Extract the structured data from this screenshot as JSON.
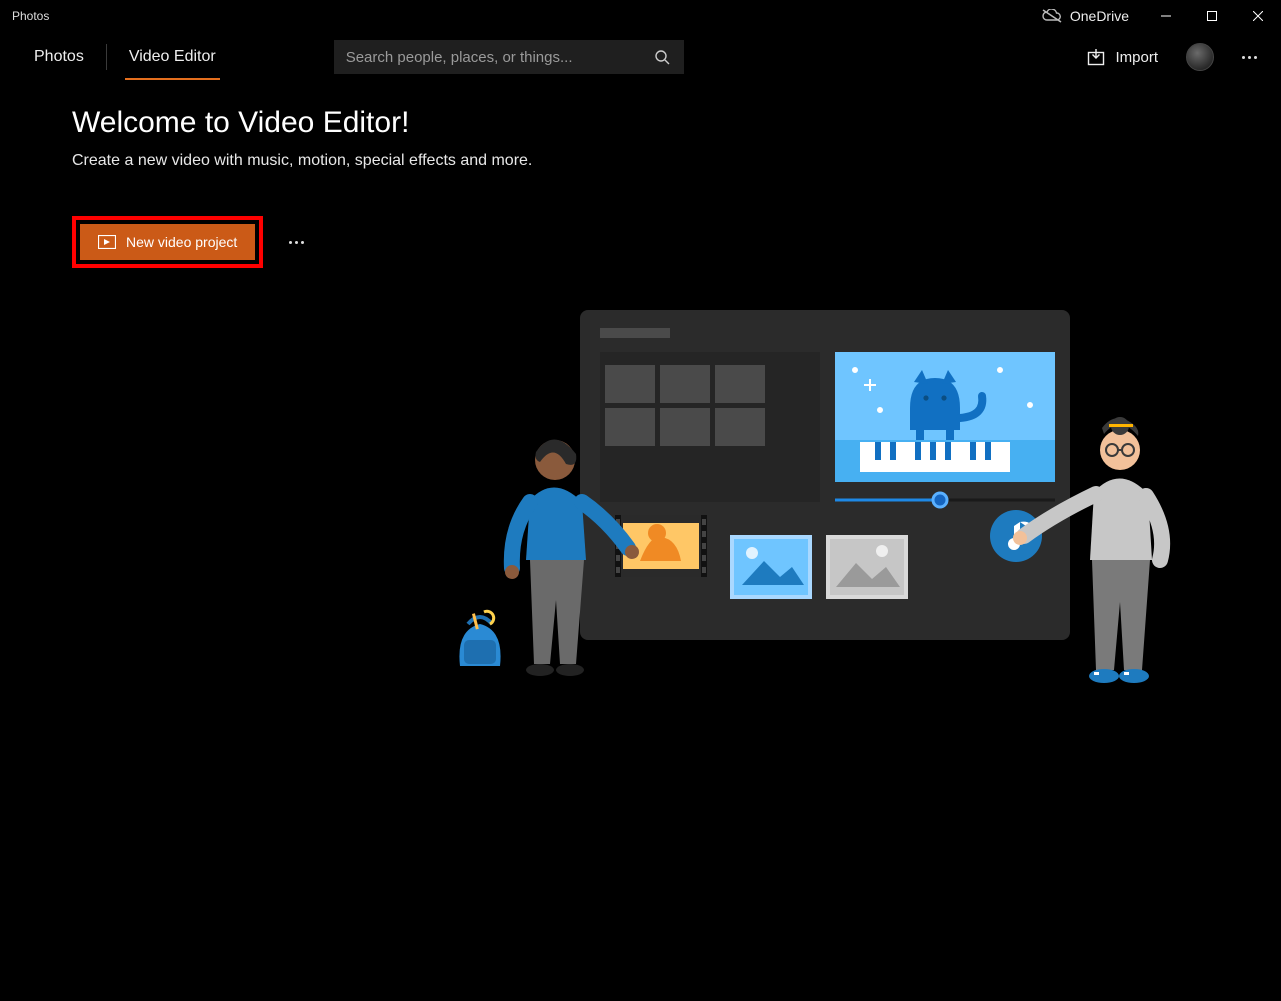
{
  "titlebar": {
    "app_name": "Photos",
    "onedrive_label": "OneDrive"
  },
  "tabs": {
    "photos": "Photos",
    "video_editor": "Video Editor",
    "active": "video_editor"
  },
  "search": {
    "placeholder": "Search people, places, or things..."
  },
  "toolbar": {
    "import_label": "Import"
  },
  "main": {
    "heading": "Welcome to Video Editor!",
    "subtitle": "Create a new video with music, motion, special effects and more.",
    "new_video_label": "New video project"
  },
  "colors": {
    "accent": "#cb5a17",
    "accent_underline": "#e56f1e",
    "highlight_border": "#ff0000"
  }
}
